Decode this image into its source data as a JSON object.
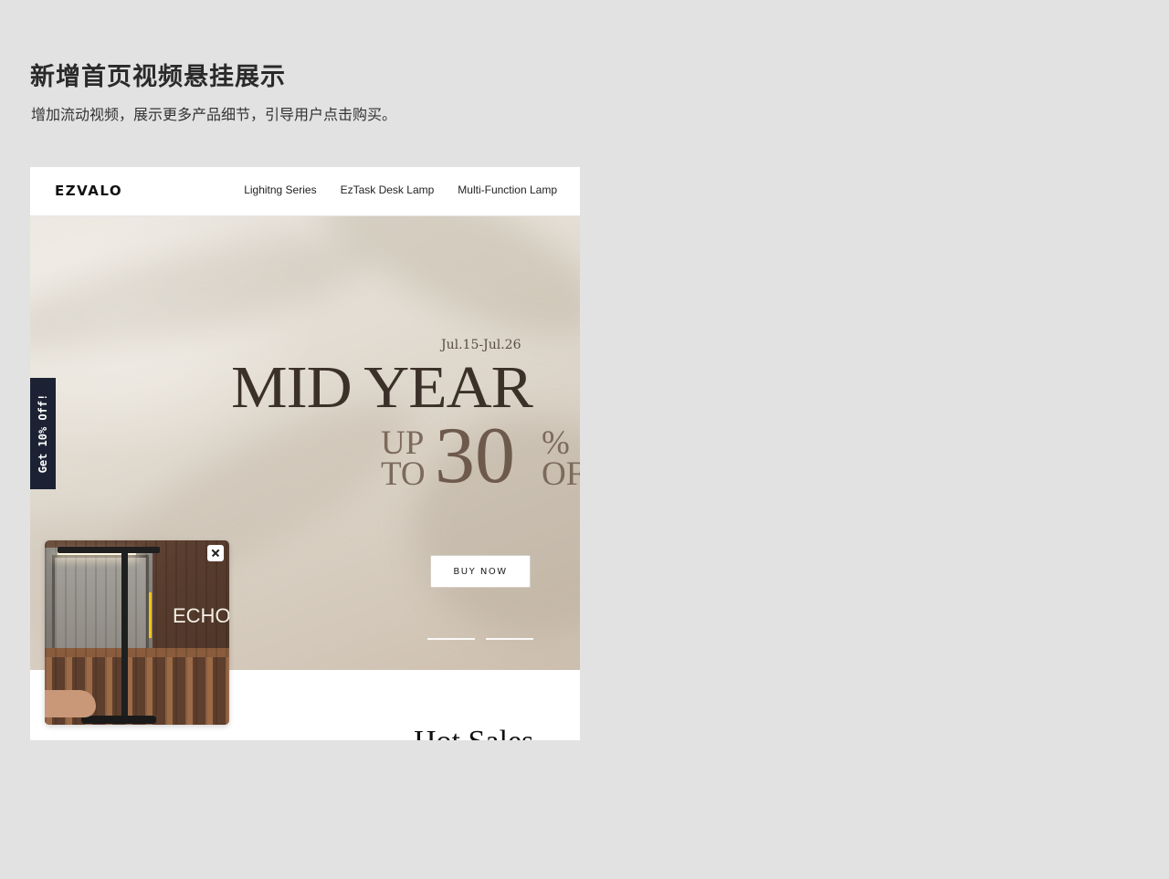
{
  "heading": {
    "title": "新增首页视频悬挂展示",
    "subtitle": "增加流动视频，展示更多产品细节，引导用户点击购买。"
  },
  "site": {
    "logo": "EZVALO",
    "nav": [
      {
        "label": "Lighitng Series"
      },
      {
        "label": "EzTask Desk Lamp"
      },
      {
        "label": "Multi-Function Lamp"
      }
    ]
  },
  "hero": {
    "date": "Jul.15-Jul.26",
    "headline": "MID YEAR",
    "up": "UP",
    "to": "TO",
    "discount": "30",
    "percent": "%",
    "off": "OFF",
    "cta": "BUY NOW",
    "carousel_count": 2
  },
  "side_tab": {
    "label": "Get 10% Off!"
  },
  "section": {
    "title": "Hot Sales"
  },
  "video_popup": {
    "caption": "ECHO",
    "accent_color": "#f0c418"
  }
}
